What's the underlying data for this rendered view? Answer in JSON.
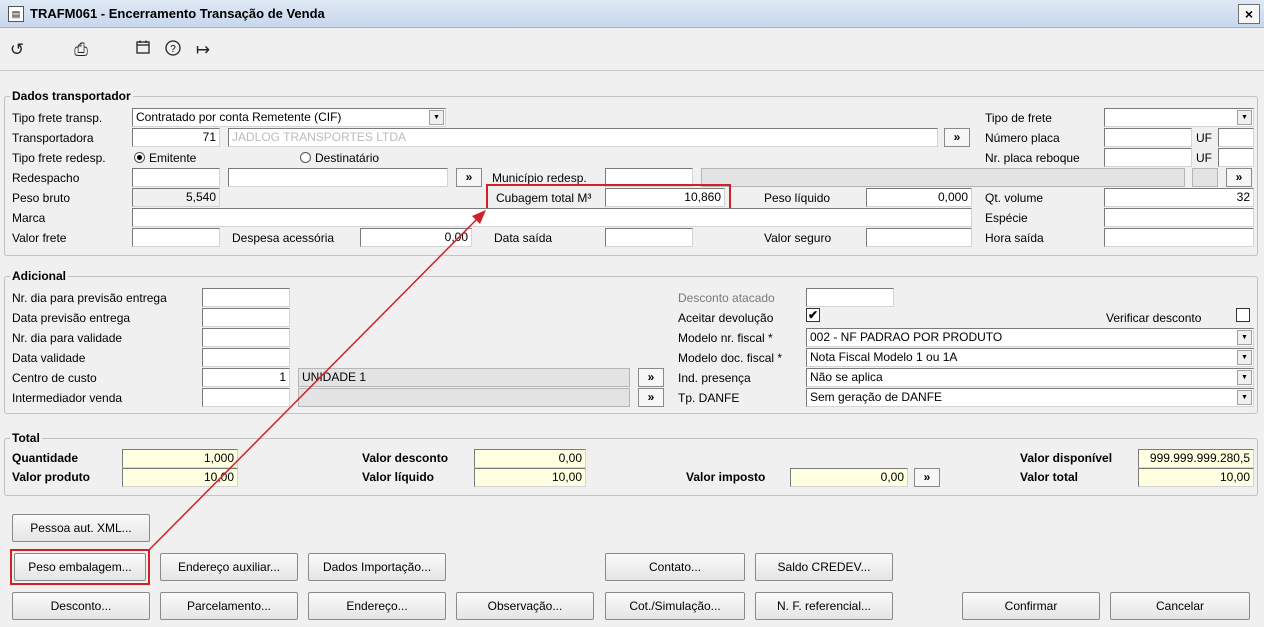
{
  "window": {
    "title": "TRAFM061 - Encerramento Transação de Venda",
    "close": "×"
  },
  "toolbar": {
    "undo": "↺",
    "print": "⎙",
    "calendar": "📅",
    "help": "?",
    "exit": "↦"
  },
  "transp": {
    "group_title": "Dados transportador",
    "tipo_frete_transp_label": "Tipo frete transp.",
    "tipo_frete_transp_value": "Contratado por conta Remetente (CIF)",
    "transportadora_label": "Transportadora",
    "transportadora_code": "71",
    "transportadora_name": "JADLOG TRANSPORTES LTDA",
    "tipo_frete_redesp_label": "Tipo frete redesp.",
    "radio_emitente": "Emitente",
    "radio_destinatario": "Destinatário",
    "redespacho_label": "Redespacho",
    "municipio_redesp_label": "Município redesp.",
    "peso_bruto_label": "Peso bruto",
    "peso_bruto_value": "5,540",
    "cubagem_label": "Cubagem total M³",
    "cubagem_value": "10,860",
    "peso_liquido_label": "Peso líquido",
    "peso_liquido_value": "0,000",
    "marca_label": "Marca",
    "valor_frete_label": "Valor frete",
    "despesa_label": "Despesa acessória",
    "despesa_value": "0,00",
    "data_saida_label": "Data saída",
    "valor_seguro_label": "Valor seguro",
    "tipo_de_frete_label": "Tipo de frete",
    "numero_placa_label": "Número placa",
    "uf_label": "UF",
    "nr_placa_reboque_label": "Nr. placa reboque",
    "qt_volume_label": "Qt. volume",
    "qt_volume_value": "32",
    "especie_label": "Espécie",
    "hora_saida_label": "Hora saída",
    "arrow": "»"
  },
  "adicional": {
    "group_title": "Adicional",
    "nr_dia_prev_label": "Nr. dia para previsão entrega",
    "data_prev_label": "Data previsão entrega",
    "nr_dia_valid_label": "Nr. dia para validade",
    "data_valid_label": "Data validade",
    "centro_custo_label": "Centro de custo",
    "centro_custo_code": "1",
    "centro_custo_name": "UNIDADE 1",
    "intermediador_label": "Intermediador venda",
    "desconto_atacado_label": "Desconto atacado",
    "aceitar_devolucao_label": "Aceitar devolução",
    "aceitar_check": "✔",
    "verificar_desconto_label": "Verificar desconto",
    "modelo_nr_fiscal_label": "Modelo nr. fiscal *",
    "modelo_nr_fiscal_value": "002 - NF PADRAO POR PRODUTO",
    "modelo_doc_fiscal_label": "Modelo doc. fiscal *",
    "modelo_doc_fiscal_value": "Nota Fiscal Modelo 1 ou 1A",
    "ind_presenca_label": "Ind. presença",
    "ind_presenca_value": "Não se aplica",
    "tp_danfe_label": "Tp. DANFE",
    "tp_danfe_value": "Sem geração de DANFE"
  },
  "total": {
    "group_title": "Total",
    "quantidade_label": "Quantidade",
    "quantidade_value": "1,000",
    "valor_produto_label": "Valor produto",
    "valor_produto_value": "10,00",
    "valor_desconto_label": "Valor desconto",
    "valor_desconto_value": "0,00",
    "valor_liquido_label": "Valor líquido",
    "valor_liquido_value": "10,00",
    "valor_imposto_label": "Valor imposto",
    "valor_imposto_value": "0,00",
    "valor_disponivel_label": "Valor disponível",
    "valor_disponivel_value": "999.999.999.280,5",
    "valor_total_label": "Valor total",
    "valor_total_value": "10,00"
  },
  "buttons": {
    "pessoa_xml": "Pessoa aut. XML...",
    "peso_embalagem": "Peso embalagem...",
    "endereco_auxiliar": "Endereço auxiliar...",
    "dados_importacao": "Dados Importação...",
    "contato": "Contato...",
    "saldo_credev": "Saldo CREDEV...",
    "desconto": "Desconto...",
    "parcelamento": "Parcelamento...",
    "endereco": "Endereço...",
    "observacao": "Observação...",
    "cot_simulacao": "Cot./Simulação...",
    "nf_referencial": "N. F. referencial...",
    "confirmar": "Confirmar",
    "cancelar": "Cancelar"
  },
  "colors": {
    "highlight": "#d0202a",
    "readonly_yellow": "#ffffe1"
  }
}
